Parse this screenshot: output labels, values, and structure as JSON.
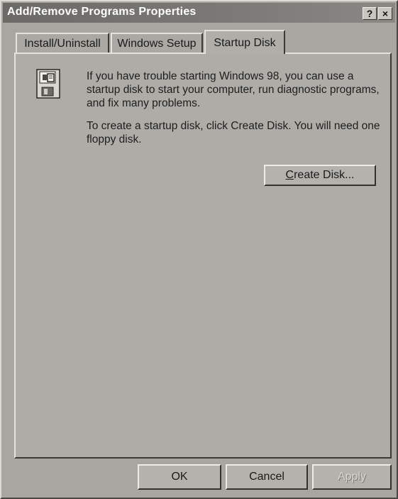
{
  "window": {
    "title": "Add/Remove Programs Properties",
    "help_button": "?",
    "close_button": "×"
  },
  "tabs": [
    {
      "label": "Install/Uninstall"
    },
    {
      "label": "Windows Setup"
    },
    {
      "label": "Startup Disk"
    }
  ],
  "active_tab": "Startup Disk",
  "panel": {
    "icon": "startup-disk-icon",
    "paragraph1": "If you have trouble starting Windows 98, you can use a startup disk to start your computer, run diagnostic programs, and fix many problems.",
    "paragraph2": "To create a startup disk, click Create Disk. You will need one floppy disk.",
    "create_disk_accel": "C",
    "create_disk_rest": "reate Disk..."
  },
  "footer": {
    "ok_label": "OK",
    "cancel_label": "Cancel",
    "apply_label": "Apply"
  }
}
